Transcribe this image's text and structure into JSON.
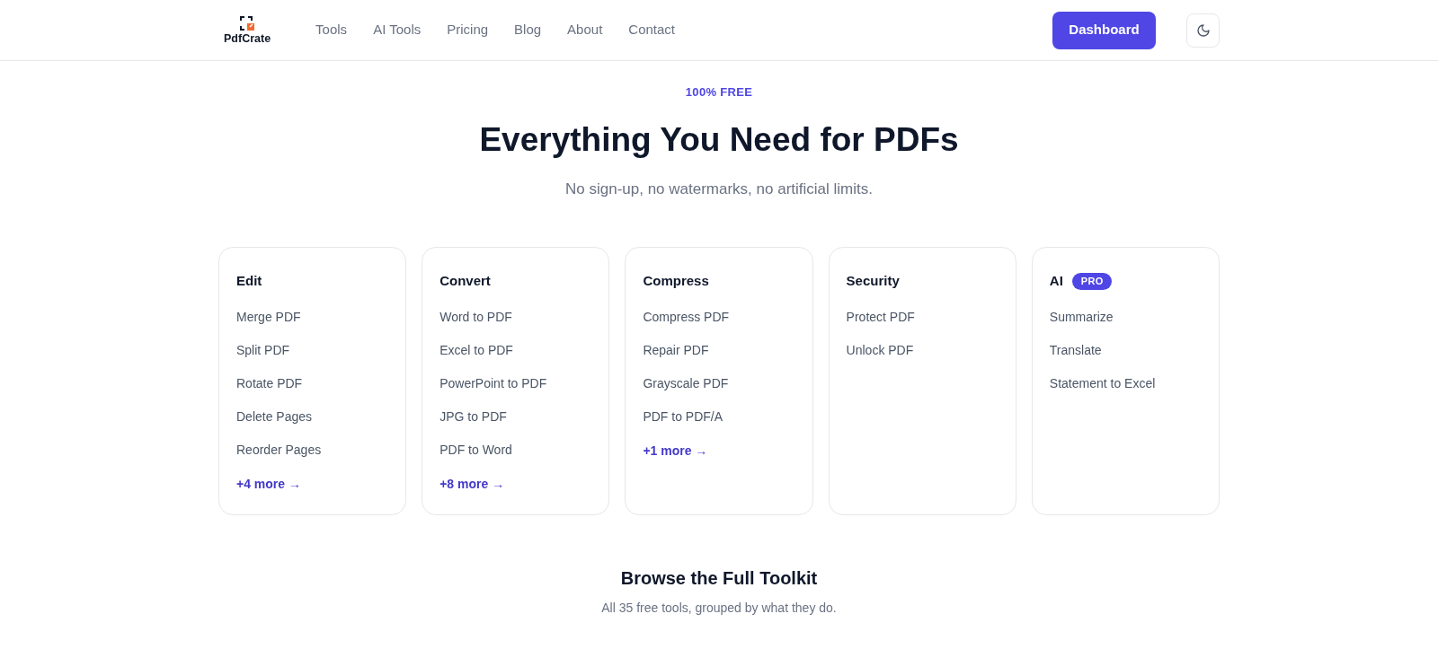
{
  "brand": {
    "name": "PdfCrate"
  },
  "nav": [
    "Tools",
    "AI Tools",
    "Pricing",
    "Blog",
    "About",
    "Contact"
  ],
  "header_actions": {
    "dashboard": "Dashboard"
  },
  "hero": {
    "eyebrow": "100% FREE",
    "title": "Everything You Need for PDFs",
    "subtitle": "No sign-up, no watermarks, no artificial limits."
  },
  "categories": [
    {
      "title": "Edit",
      "tools": [
        "Merge PDF",
        "Split PDF",
        "Rotate PDF",
        "Delete Pages",
        "Reorder Pages"
      ],
      "more": "+4 more →"
    },
    {
      "title": "Convert",
      "tools": [
        "Word to PDF",
        "Excel to PDF",
        "PowerPoint to PDF",
        "JPG to PDF",
        "PDF to Word"
      ],
      "more": "+8 more →"
    },
    {
      "title": "Compress",
      "tools": [
        "Compress PDF",
        "Repair PDF",
        "Grayscale PDF",
        "PDF to PDF/A"
      ],
      "more": "+1 more →"
    },
    {
      "title": "Security",
      "tools": [
        "Protect PDF",
        "Unlock PDF"
      ]
    },
    {
      "title": "AI",
      "badge": "PRO",
      "tools": [
        "Summarize",
        "Translate",
        "Statement to Excel"
      ]
    }
  ],
  "toolkit": {
    "title": "Browse the Full Toolkit",
    "subtitle": "All 35 free tools, grouped by what they do."
  }
}
